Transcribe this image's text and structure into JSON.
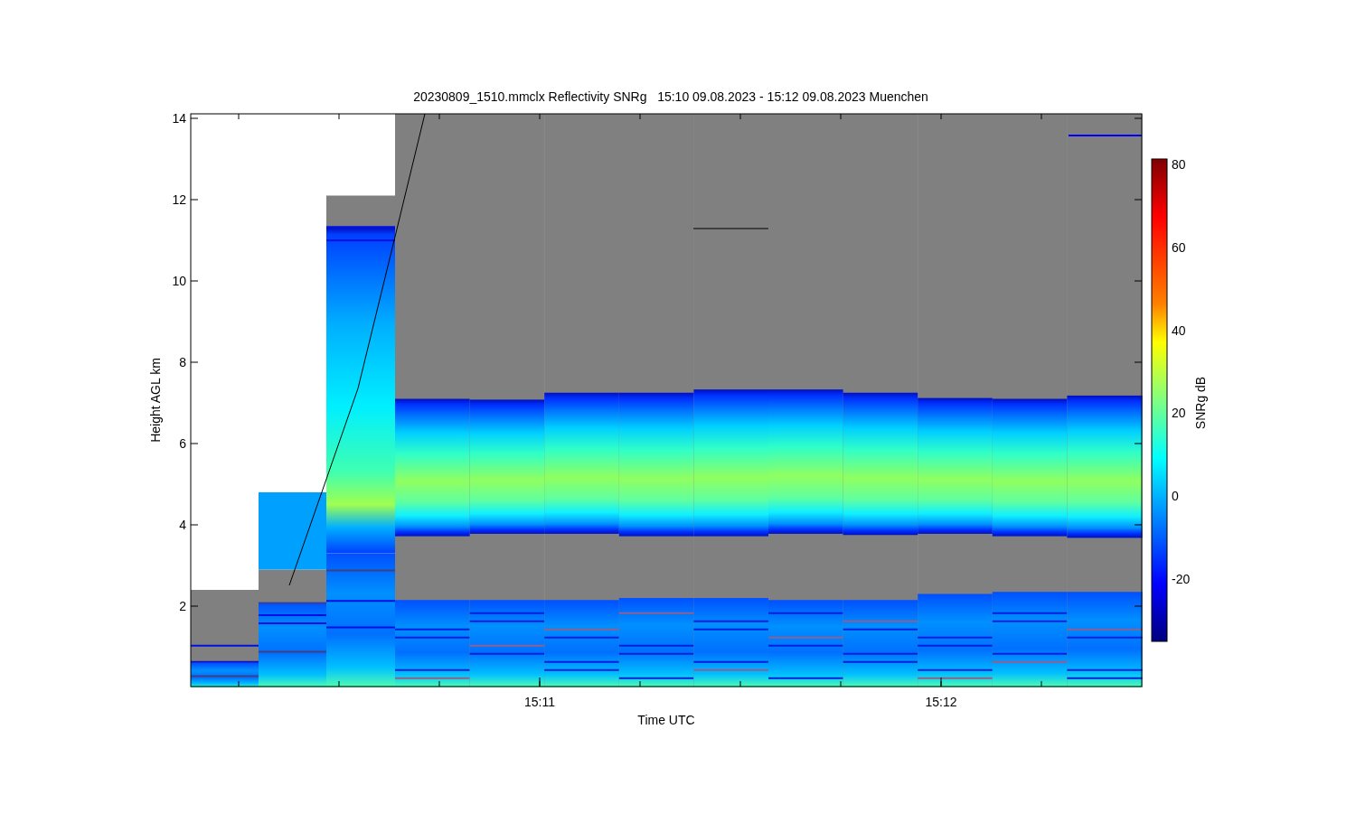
{
  "title": "20230809_1510.mmclx Reflectivity SNRg   15:10 09.08.2023 - 15:12 09.08.2023 Muenchen",
  "y_axis": {
    "label": "Height AGL km",
    "ticks": [
      "14",
      "12",
      "10",
      "8",
      "6",
      "4",
      "2"
    ]
  },
  "x_axis": {
    "label": "Time UTC",
    "ticks": [
      "15:11",
      "15:12"
    ]
  },
  "colorbar": {
    "label": "SNRg dB",
    "ticks": [
      "80",
      "60",
      "40",
      "20",
      "0",
      "-20"
    ]
  }
}
